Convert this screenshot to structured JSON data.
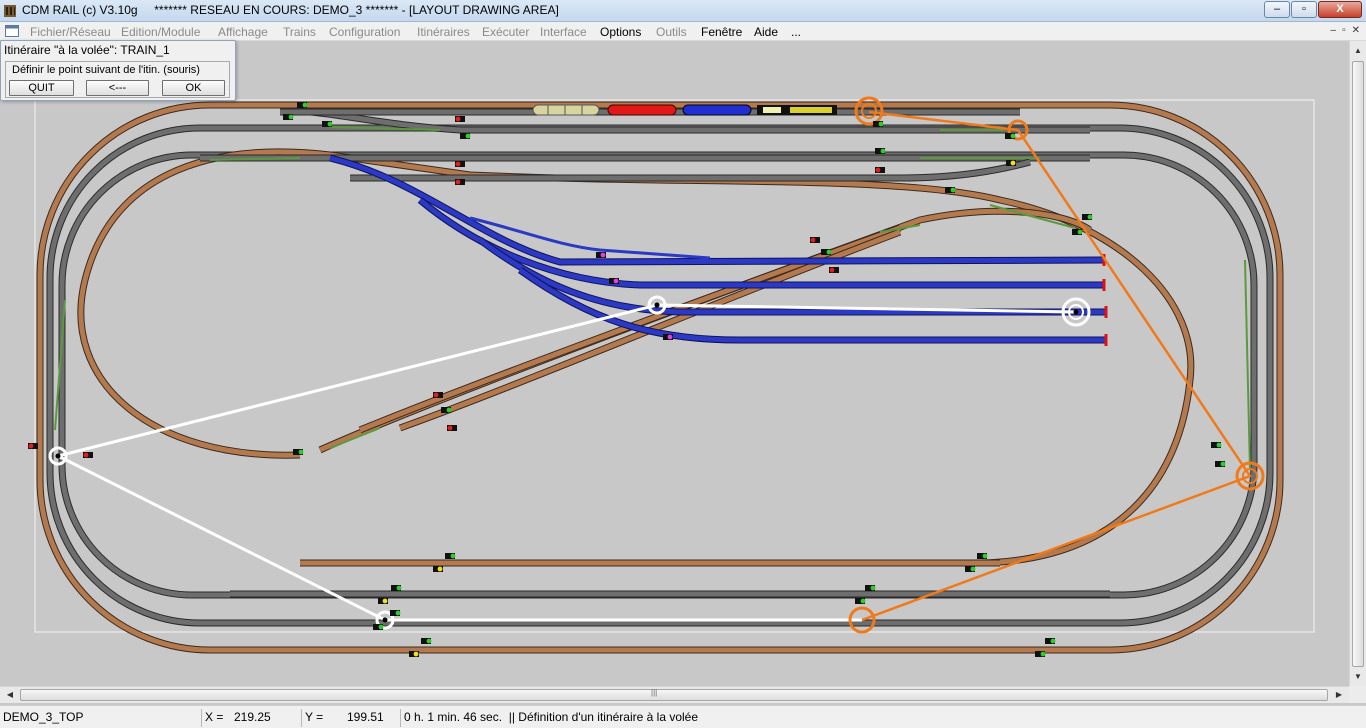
{
  "window": {
    "title": "CDM RAIL (c) V3.10g     ******* RESEAU EN COURS: DEMO_3 ******* - [LAYOUT DRAWING AREA]",
    "buttons": {
      "minimize": "–",
      "maximize": "▫",
      "close": "X"
    }
  },
  "menu": {
    "items": [
      {
        "label": "Fichier/Réseau",
        "enabled": false
      },
      {
        "label": "Edition/Module",
        "enabled": false
      },
      {
        "label": "Affichage",
        "enabled": false
      },
      {
        "label": "Trains",
        "enabled": false
      },
      {
        "label": "Configuration",
        "enabled": false
      },
      {
        "label": "Itinéraires",
        "enabled": false
      },
      {
        "label": "Exécuter",
        "enabled": false
      },
      {
        "label": "Interface",
        "enabled": false
      },
      {
        "label": "Options",
        "enabled": true
      },
      {
        "label": "Outils",
        "enabled": false
      },
      {
        "label": "Fenêtre",
        "enabled": true
      },
      {
        "label": "Aide",
        "enabled": true
      },
      {
        "label": "...",
        "enabled": true
      }
    ],
    "mdi_buttons": [
      "–",
      "▫",
      "✕"
    ]
  },
  "dialog": {
    "title": "Itinéraire \"à la volée\": TRAIN_1",
    "hint": "Définir le point suivant de l'itin. (souris)",
    "quit_label": "QUIT",
    "back_label": "<---",
    "ok_label": "OK"
  },
  "status": {
    "module": "DEMO_3_TOP",
    "x_label": "X =",
    "x_value": "219.25",
    "y_label": "Y =",
    "y_value": "199.51",
    "message": "0 h. 1 min. 46 sec.  || Définition d'un itinéraire à la volée"
  },
  "colors": {
    "canvas": "#c8c8c8",
    "track_grey": "#6e6e6e",
    "track_brown": "#b47a4e",
    "track_blue": "#2b39c4",
    "track_green": "#5a9a3c",
    "route_white": "#ffffff",
    "route_orange": "#f07a1a",
    "signal_green": "#2ecc2e",
    "signal_red": "#e02020",
    "signal_yellow": "#f0e020"
  },
  "icons": {
    "app": "cdm-rail-app-icon",
    "mdi": "mdi-document-icon"
  }
}
